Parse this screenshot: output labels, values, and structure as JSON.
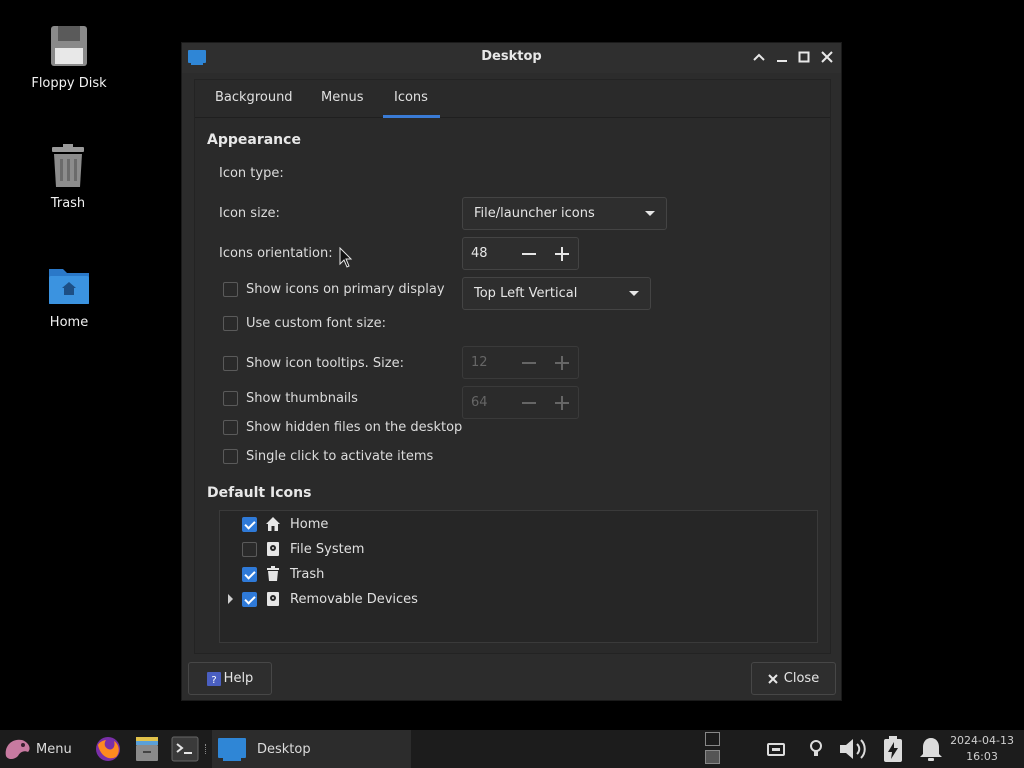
{
  "desktop_icons": {
    "floppy": "Floppy Disk",
    "trash": "Trash",
    "home": "Home"
  },
  "window": {
    "title": "Desktop",
    "tabs": [
      "Background",
      "Menus",
      "Icons"
    ],
    "active_tab": "Icons",
    "appearance": {
      "title": "Appearance",
      "icon_type_label": "Icon type:",
      "icon_type_value": "File/launcher icons",
      "icon_size_label": "Icon size:",
      "icon_size_value": "48",
      "orientation_label": "Icons orientation:",
      "orientation_value": "Top Left Vertical",
      "checkboxes": [
        {
          "label": "Show icons on primary display",
          "checked": false
        },
        {
          "label": "Use custom font size:",
          "checked": false,
          "spin_value": "12"
        },
        {
          "label": "Show icon tooltips. Size:",
          "checked": false,
          "spin_value": "64"
        },
        {
          "label": "Show thumbnails",
          "checked": false
        },
        {
          "label": "Show hidden files on the desktop",
          "checked": false
        },
        {
          "label": "Single click to activate items",
          "checked": false
        }
      ]
    },
    "default_icons": {
      "title": "Default Icons",
      "items": [
        {
          "label": "Home",
          "checked": true,
          "icon": "home-icon"
        },
        {
          "label": "File System",
          "checked": false,
          "icon": "drive-icon"
        },
        {
          "label": "Trash",
          "checked": true,
          "icon": "trash-icon"
        },
        {
          "label": "Removable Devices",
          "checked": true,
          "icon": "drive-icon",
          "expandable": true
        }
      ]
    },
    "help_label": "Help",
    "close_label": "Close"
  },
  "panel": {
    "menu_label": "Menu",
    "task_label": "Desktop",
    "date": "2024-04-13",
    "time": "16:03"
  },
  "colors": {
    "accent": "#2f7ad8",
    "folder": "#2f86d6"
  }
}
